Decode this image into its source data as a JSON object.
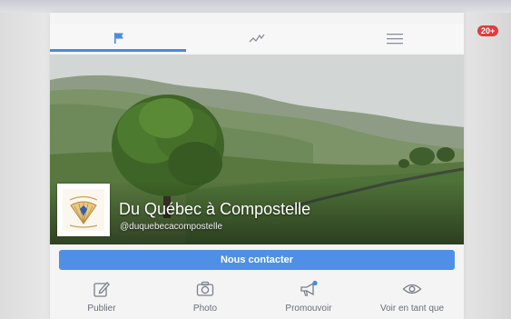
{
  "tabs": [
    {
      "icon": "flag-icon",
      "active": true
    },
    {
      "icon": "activity-chart-icon",
      "active": false
    },
    {
      "icon": "menu-icon",
      "active": false,
      "badge": "20+"
    }
  ],
  "page": {
    "name": "Du Québec à Compostelle",
    "handle": "@duquebecacompostelle"
  },
  "contact_button": {
    "label": "Nous contacter"
  },
  "actions": [
    {
      "icon": "edit-icon",
      "label": "Publier"
    },
    {
      "icon": "camera-icon",
      "label": "Photo"
    },
    {
      "icon": "megaphone-icon",
      "label": "Promouvoir"
    },
    {
      "icon": "eye-icon",
      "label": "Voir en tant que"
    }
  ],
  "colors": {
    "accent": "#4a8ae0",
    "contact_button": "#4f8fe6",
    "badge": "#e43b3b",
    "action_text": "#6a6f78"
  }
}
